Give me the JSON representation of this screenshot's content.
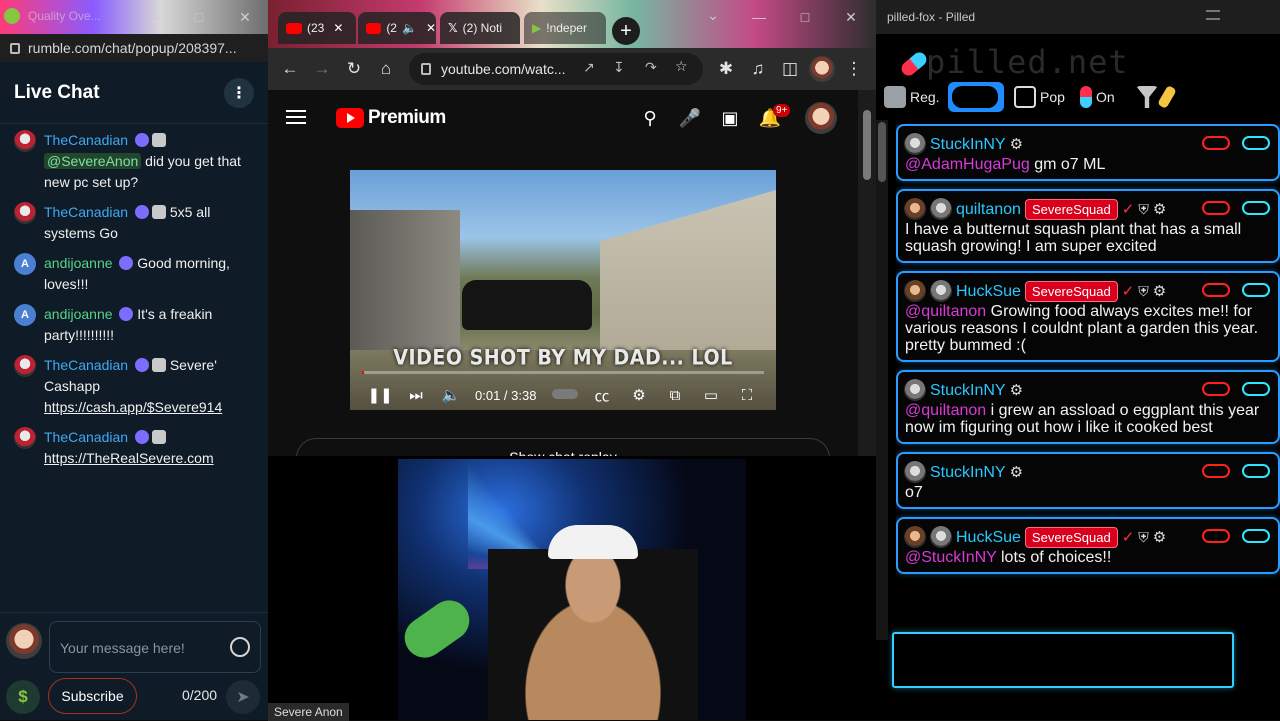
{
  "rumble": {
    "window_title": "Quality Ove...",
    "url": "rumble.com/chat/popup/208397...",
    "chat_title": "Live Chat",
    "messages": [
      {
        "user": "TheCanadian",
        "mention": "@SevereAnon",
        "text": "did you get that new pc set up?"
      },
      {
        "user": "TheCanadian",
        "text": "5x5 all systems Go"
      },
      {
        "user": "andijoanne",
        "avatar_letter": "A",
        "text": "Good morning, loves!!!"
      },
      {
        "user": "andijoanne",
        "avatar_letter": "A",
        "text": "It's a freakin party!!!!!!!!!!"
      },
      {
        "user": "TheCanadian",
        "text": "Severe' Cashapp",
        "link": "https://cash.app/$Severe914"
      },
      {
        "user": "TheCanadian",
        "link": "https://TheRealSevere.com"
      }
    ],
    "input_placeholder": "Your message here!",
    "subscribe_label": "Subscribe",
    "char_count": "0/200",
    "dollar_symbol": "$"
  },
  "chrome": {
    "tabs": [
      {
        "label": "(23"
      },
      {
        "label": "(2"
      },
      {
        "label": "(2) Noti"
      },
      {
        "label": "!ndeper"
      }
    ],
    "new_tab": "+",
    "url": "youtube.com/watc..."
  },
  "youtube": {
    "logo_text": "Premium",
    "notif_count": "9+",
    "video_caption": "VIDEO SHOT BY MY DAD... LOL",
    "time_current": "0:01",
    "time_total": "3:38",
    "progress": 0.005,
    "show_chat_replay": "Show chat replay"
  },
  "webcam": {
    "label": "Severe Anon"
  },
  "pilled": {
    "window_title": "pilled-fox - Pilled",
    "brand": "pilled.net",
    "toolbar": {
      "reg": "Reg.",
      "pop": "Pop",
      "on": "On"
    },
    "messages": [
      {
        "user": "StuckInNY",
        "mention": "@AdamHugaPug",
        "text": "gm o7 ML"
      },
      {
        "user": "quiltanon",
        "squad": "SevereSquad",
        "text": "I have a butternut squash plant that has a small squash growing! I am super excited"
      },
      {
        "user": "HuckSue",
        "squad": "SevereSquad",
        "mention": "@quiltanon",
        "text": "Growing food always excites me!! for various reasons I couldnt plant a garden this year. pretty bummed :("
      },
      {
        "user": "StuckInNY",
        "mention": "@quiltanon",
        "text": "i grew an assload o eggplant this year now im figuring out how i like it cooked best"
      },
      {
        "user": "StuckInNY",
        "text": "o7"
      },
      {
        "user": "HuckSue",
        "squad": "SevereSquad",
        "mention": "@StuckInNY",
        "text": "lots of choices!!"
      }
    ]
  },
  "colors": {
    "rumble_bg": "#0f1b26",
    "rumble_green": "#85c742",
    "pilled_border": "#2a9cff",
    "squad_red": "#d9001d",
    "yt_red": "#ff0000"
  }
}
